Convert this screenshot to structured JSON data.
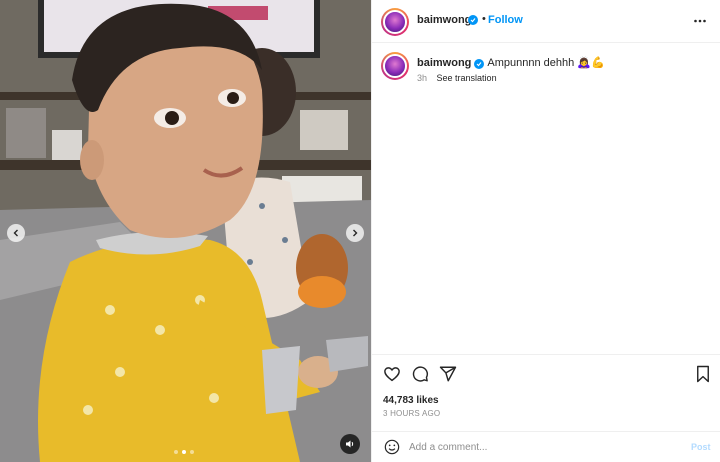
{
  "post": {
    "username": "baimwong",
    "follow_label": "Follow",
    "separator": "•",
    "caption_text": "Ampunnnn dehhh 🙇‍♀️💪",
    "time_ago": "3h",
    "see_translation": "See translation",
    "likes": "44,783 likes",
    "timestamp": "3 HOURS AGO",
    "verified": true
  },
  "media": {
    "description_icon": "video-carousel",
    "carousel_count": 3,
    "carousel_active_index": 1,
    "audio_state": "sound-on"
  },
  "comment_box": {
    "placeholder": "Add a comment...",
    "post_label": "Post"
  },
  "colors": {
    "accent": "#0095f6",
    "text": "#262626",
    "muted": "#8e8e8e",
    "post_disabled": "#b3dbff",
    "divider": "#efefef"
  },
  "icons": {
    "more": "more-horizontal-icon",
    "like": "heart-icon",
    "comment": "comment-icon",
    "share": "paper-plane-icon",
    "save": "bookmark-icon",
    "emoji": "smiley-icon",
    "audio": "speaker-icon",
    "prev": "chevron-left-icon",
    "next": "chevron-right-icon"
  }
}
